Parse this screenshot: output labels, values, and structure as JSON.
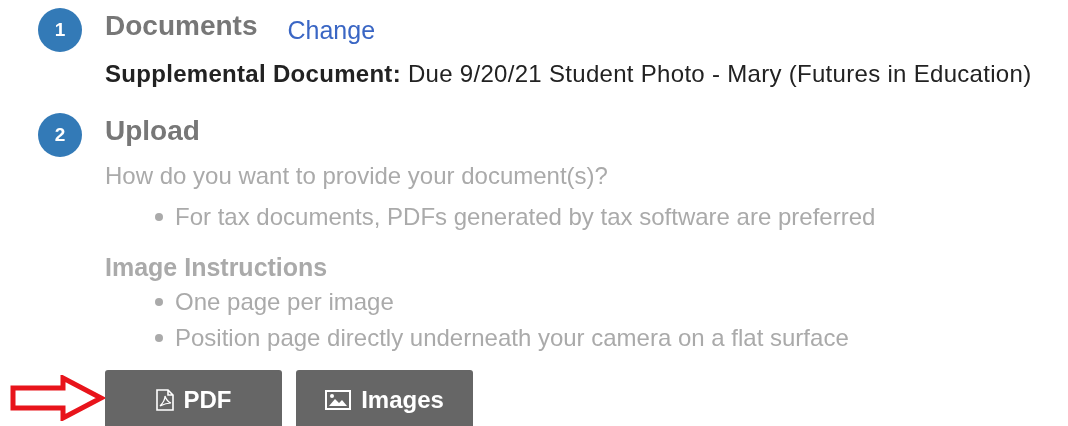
{
  "documents_step": {
    "number": "1",
    "title": "Documents",
    "link": "Change",
    "label": "Supplemental Document:",
    "value": "Due 9/20/21 Student Photo - Mary (Futures in Education)"
  },
  "upload_step": {
    "number": "2",
    "title": "Upload",
    "prompt": "How do you want to provide your document(s)?",
    "bullets": [
      "For tax documents, PDFs generated by tax software are preferred"
    ],
    "instructions_heading": "Image Instructions",
    "instructions": [
      "One page per image",
      "Position page directly underneath your camera on a flat surface"
    ]
  },
  "buttons": [
    {
      "label": "PDF",
      "kind": "pdf",
      "arrow": true
    },
    {
      "label": "Images",
      "kind": "image",
      "arrow": false
    }
  ]
}
